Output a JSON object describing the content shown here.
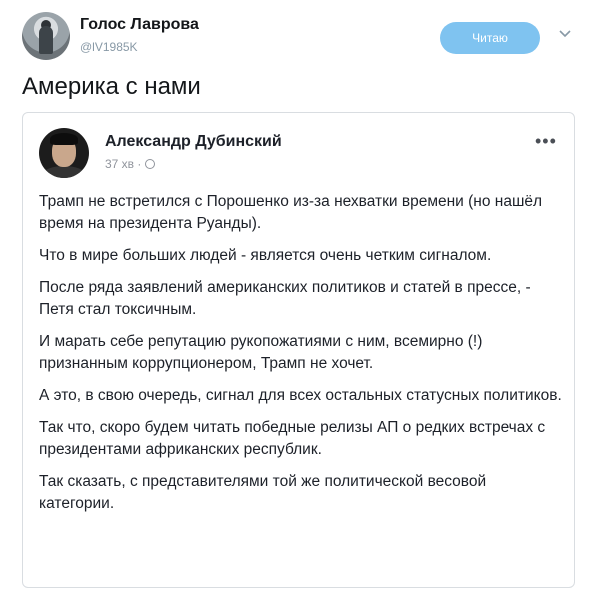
{
  "tweet": {
    "author_name": "Голос Лаврова",
    "author_handle": "@lV1985K",
    "follow_label": "Читаю",
    "text": "Америка с нами"
  },
  "fb_post": {
    "author": "Александр Дубинский",
    "time": "37 хв ·",
    "paragraphs": [
      "Трамп не встретился с Порошенко из-за нехватки времени (но нашёл время на президента Руанды).",
      "Что в мире больших людей - является очень четким сигналом.",
      "После ряда заявлений американских политиков и статей в прессе, - Петя стал токсичным.",
      "И марать себе репутацию рукопожатиями с ним, всемирно (!) признанным коррупционером, Трамп не хочет.",
      "А это, в свою очередь, сигнал для всех остальных статусных политиков.",
      "Так что, скоро будем читать победные релизы АП о редких встречах с президентами африканских республик.",
      "Так сказать, с представителями той же политической весовой категории."
    ]
  },
  "icons": {
    "chevron": "chevron-down-icon",
    "globe": "globe-icon",
    "more": "more-options-icon"
  },
  "colors": {
    "follow_button": "#7fc3f0",
    "handle": "#8899a6",
    "card_border": "#d9dde1"
  }
}
